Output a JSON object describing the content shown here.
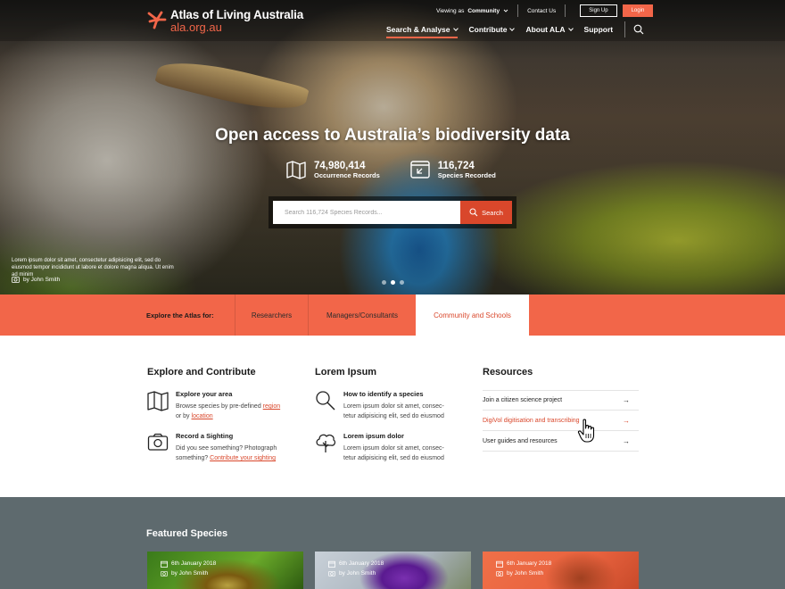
{
  "brand": {
    "title": "Atlas of Living Australia",
    "url_text": "ala.org.au",
    "accent": "#f26649"
  },
  "utility": {
    "viewing_as_label": "Viewing as",
    "viewing_as_value": "Community",
    "contact": "Contact Us",
    "signup": "Sign Up",
    "login": "Login"
  },
  "nav": {
    "items": [
      {
        "label": "Search & Analyse"
      },
      {
        "label": "Contribute"
      },
      {
        "label": "About ALA"
      },
      {
        "label": "Support"
      }
    ],
    "search_icon": "search-icon"
  },
  "hero": {
    "title": "Open access to Australia’s biodiversity data",
    "stats": [
      {
        "value": "74,980,414",
        "label": "Occurrence Records",
        "icon": "map-icon"
      },
      {
        "value": "116,724",
        "label": "Species Recorded",
        "icon": "species-window-icon"
      }
    ],
    "search_placeholder": "Search 116,724 Species Records...",
    "search_button": "Search",
    "caption": "Lorem ipsum dolor sit amet, consectetur adipisicing elit, sed do eiusmod tempor incididunt ut labore et dolore magna aliqua. Ut enim ad minim",
    "photographer": "by John Smith",
    "slides": 3,
    "active_slide": 2
  },
  "explore": {
    "label": "Explore the Atlas for:",
    "tabs": [
      {
        "label": "Researchers"
      },
      {
        "label": "Managers/Consultants"
      },
      {
        "label": "Community and Schools"
      }
    ],
    "active_tab": 2
  },
  "columns": {
    "explore_contribute": {
      "heading": "Explore and Contribute",
      "items": [
        {
          "title": "Explore your area",
          "text_a": "Browse species by pre-defined ",
          "link_a": "region",
          "text_b": "or by ",
          "link_b": "location"
        },
        {
          "title": "Record a Sighting",
          "text_a": "Did you see something? Photograph",
          "text_b": "something? ",
          "link_b": "Contribute your sighting"
        }
      ]
    },
    "lorem": {
      "heading": "Lorem Ipsum",
      "items": [
        {
          "title": "How to identify a species",
          "line1": "Lorem ipsum dolor sit amet, consec-",
          "line2": "tetur adipisicing elit, sed do eiusmod"
        },
        {
          "title": "Lorem ipsum dolor",
          "line1": "Lorem ipsum dolor sit amet, consec-",
          "line2": "tetur adipisicing elit, sed do eiusmod"
        }
      ]
    },
    "resources": {
      "heading": "Resources",
      "links": [
        {
          "label": "Join a citizen science project",
          "arrow": "→"
        },
        {
          "label": "DigiVol digitisation and transcribing",
          "arrow": "→"
        },
        {
          "label": "User guides and resources",
          "arrow": "→"
        }
      ]
    }
  },
  "featured": {
    "heading": "Featured Species",
    "cards": [
      {
        "date": "6th January 2018",
        "author": "by John Smith"
      },
      {
        "date": "6th January 2018",
        "author": "by John Smith"
      },
      {
        "date": "6th January 2018",
        "author": "by John Smith"
      }
    ]
  }
}
